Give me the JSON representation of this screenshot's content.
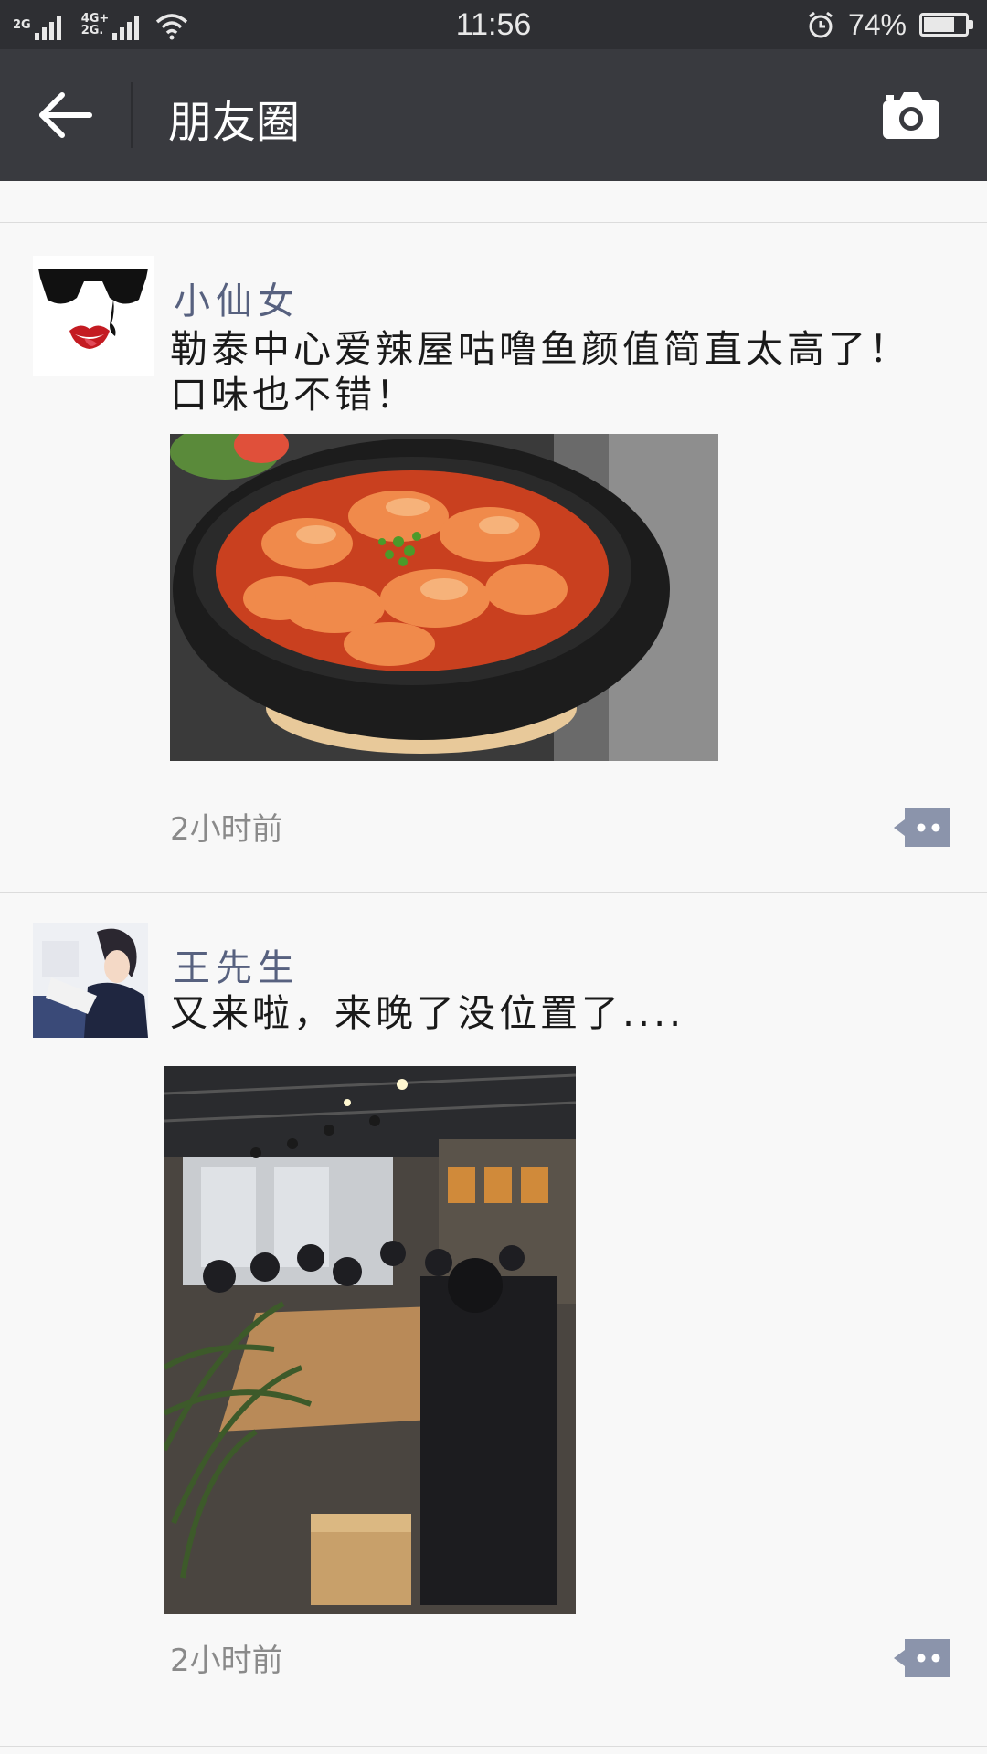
{
  "status_bar": {
    "network_top": "2G",
    "network_mid": "4G+",
    "network_bot": "2G.",
    "time": "11:56",
    "battery_percent_label": "74%",
    "battery_level": 0.74
  },
  "nav": {
    "title": "朋友圈"
  },
  "posts": [
    {
      "name": "小仙女",
      "content": "勒泰中心爱辣屋咕噜鱼颜值简直太高了！口味也不错！",
      "time": "2小时前"
    },
    {
      "name": "王先生",
      "content": "又来啦，来晚了没位置了....",
      "time": "2小时前"
    }
  ],
  "colors": {
    "status_bar_bg": "#2e2f33",
    "nav_bg": "#393a3f",
    "name_color": "#57617f",
    "comment_icon": "#8b94ab"
  },
  "icons": {
    "back": "arrow-left-icon",
    "camera": "camera-icon",
    "comment": "comment-icon",
    "wifi": "wifi-icon",
    "alarm": "alarm-icon",
    "battery": "battery-icon"
  }
}
